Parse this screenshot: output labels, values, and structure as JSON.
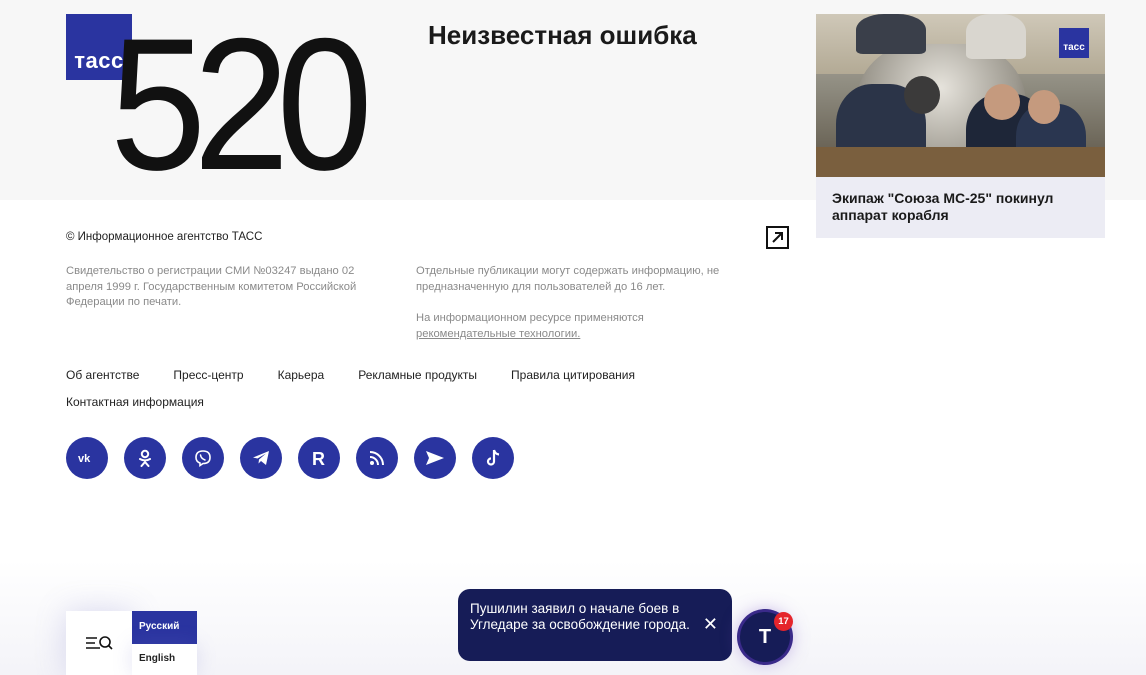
{
  "header": {
    "logo_text": "тасс",
    "error_code": "520",
    "error_title": "Неизвестная ошибка"
  },
  "news_card": {
    "badge": "тасс",
    "title": "Экипаж \"Союза МС-25\" покинул аппарат корабля"
  },
  "footer": {
    "copyright": "© Информационное агентство ТАСС",
    "registration": "Свидетельство о регистрации СМИ №03247 выдано 02 апреля 1999 г. Государственным комитетом Российской Федерации по печати.",
    "age_notice": "Отдельные публикации могут содержать информацию, не предназначенную для пользователей до 16 лет.",
    "tech_prefix": "На информационном ресурсе применяются",
    "tech_link": "рекомендательные технологии.",
    "nav": [
      "Об агентстве",
      "Пресс-центр",
      "Карьера",
      "Рекламные продукты",
      "Правила цитирования"
    ],
    "nav_extra": "Контактная информация",
    "socials": [
      {
        "name": "vk-icon",
        "glyph": "vk"
      },
      {
        "name": "odnoklassniki-icon",
        "glyph": "ok"
      },
      {
        "name": "viber-icon",
        "glyph": "viber"
      },
      {
        "name": "telegram-icon",
        "glyph": "tg"
      },
      {
        "name": "rutube-icon",
        "glyph": "R"
      },
      {
        "name": "rss-icon",
        "glyph": "rss"
      },
      {
        "name": "send-icon",
        "glyph": "send"
      },
      {
        "name": "tiktok-icon",
        "glyph": "tiktok"
      }
    ]
  },
  "language": {
    "ru": "Русский",
    "en": "English"
  },
  "toast": {
    "text": "Пушилин заявил о начале боев в Угледаре за освобождение города.",
    "close": "✕"
  },
  "feed_button": {
    "label": "T",
    "badge_count": "17"
  },
  "colors": {
    "brand": "#2a34a0",
    "toast_bg": "#161c57",
    "badge": "#e5252c"
  }
}
